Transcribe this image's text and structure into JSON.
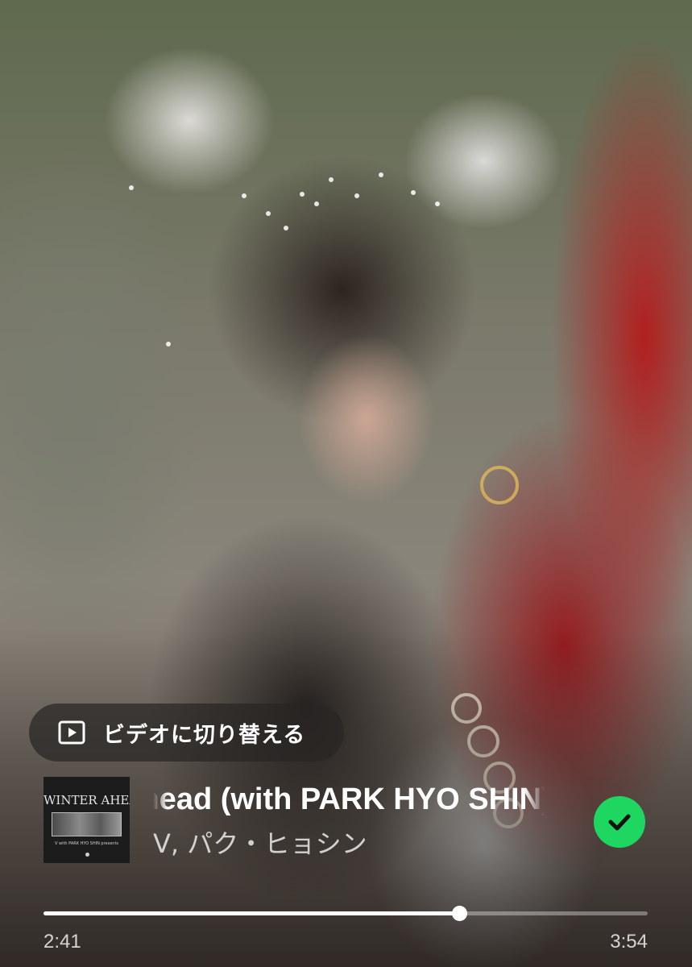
{
  "canvas": {
    "description_icon": "video-canvas-background"
  },
  "switch_video": {
    "icon": "play-square-icon",
    "label": "ビデオに切り替える"
  },
  "track": {
    "title": "Winter Ahead (with PARK HYO SHIN)",
    "artists": "V, パク・ヒョシン",
    "album_art_title": "WINTER AHEAD",
    "album_art_credit": "V with PARK HYO SHIN presents",
    "saved": true,
    "saved_icon": "check-icon"
  },
  "playback": {
    "elapsed": "2:41",
    "total": "3:54",
    "progress_fraction": 0.688
  },
  "colors": {
    "accent_green": "#1ed760",
    "text_primary": "#ffffff"
  }
}
